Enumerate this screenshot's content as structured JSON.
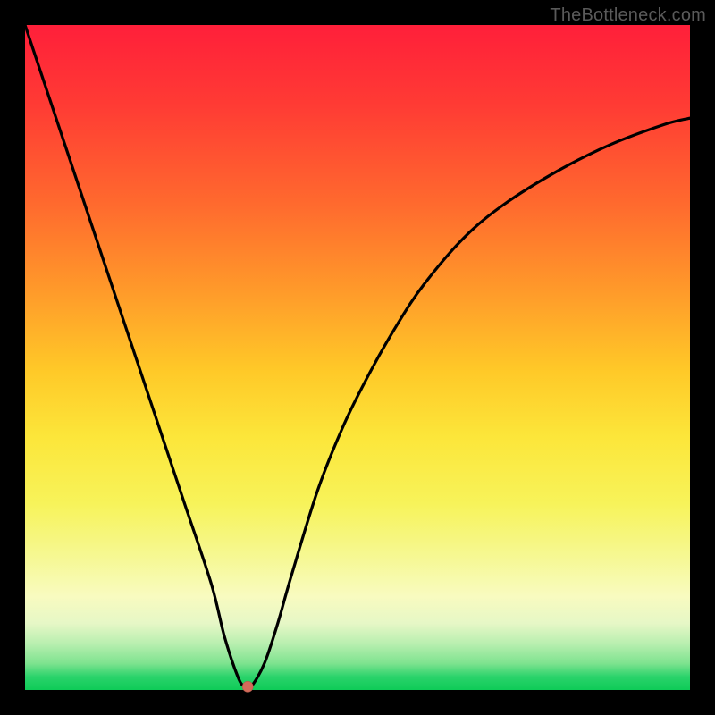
{
  "watermark": "TheBottleneck.com",
  "chart_data": {
    "type": "line",
    "title": "",
    "xlabel": "",
    "ylabel": "",
    "xlim": [
      0,
      100
    ],
    "ylim": [
      0,
      100
    ],
    "background_gradient": {
      "direction": "vertical",
      "stops": [
        {
          "pos": 0,
          "color": "#ff1f3a"
        },
        {
          "pos": 0.5,
          "color": "#ffc928"
        },
        {
          "pos": 0.97,
          "color": "#2bd36b"
        },
        {
          "pos": 1.0,
          "color": "#0ecb57"
        }
      ]
    },
    "series": [
      {
        "name": "bottleneck-curve",
        "color": "#000000",
        "x": [
          0,
          4,
          8,
          12,
          16,
          20,
          24,
          28,
          30,
          32,
          33,
          34,
          36,
          38,
          40,
          44,
          48,
          52,
          56,
          60,
          66,
          72,
          80,
          88,
          96,
          100
        ],
        "values": [
          100,
          88,
          76,
          64,
          52,
          40,
          28,
          16,
          8,
          2,
          0.5,
          0.5,
          4,
          10,
          17,
          30,
          40,
          48,
          55,
          61,
          68,
          73,
          78,
          82,
          85,
          86
        ]
      }
    ],
    "marker": {
      "name": "optimal-point",
      "x": 33.5,
      "y": 0.5,
      "color": "#d36b5a",
      "radius_px": 6
    }
  }
}
